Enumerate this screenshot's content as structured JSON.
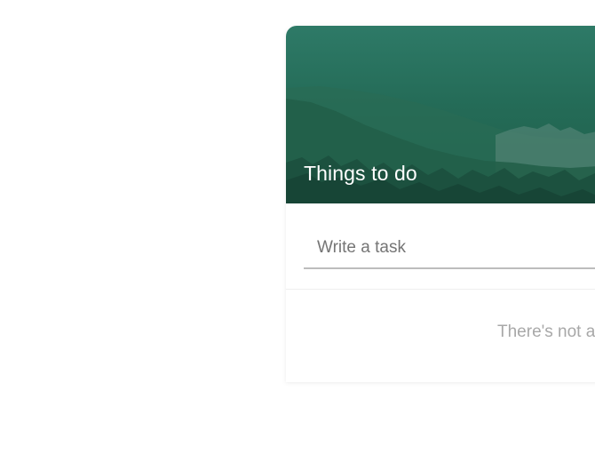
{
  "card": {
    "title": "Things to do"
  },
  "task_input": {
    "placeholder": "Write a task",
    "value": ""
  },
  "empty_state": {
    "message": "There's not a"
  },
  "colors": {
    "header_green": "#246b57",
    "muted_text": "#a8a8a8",
    "input_underline": "#bdbdbd"
  }
}
